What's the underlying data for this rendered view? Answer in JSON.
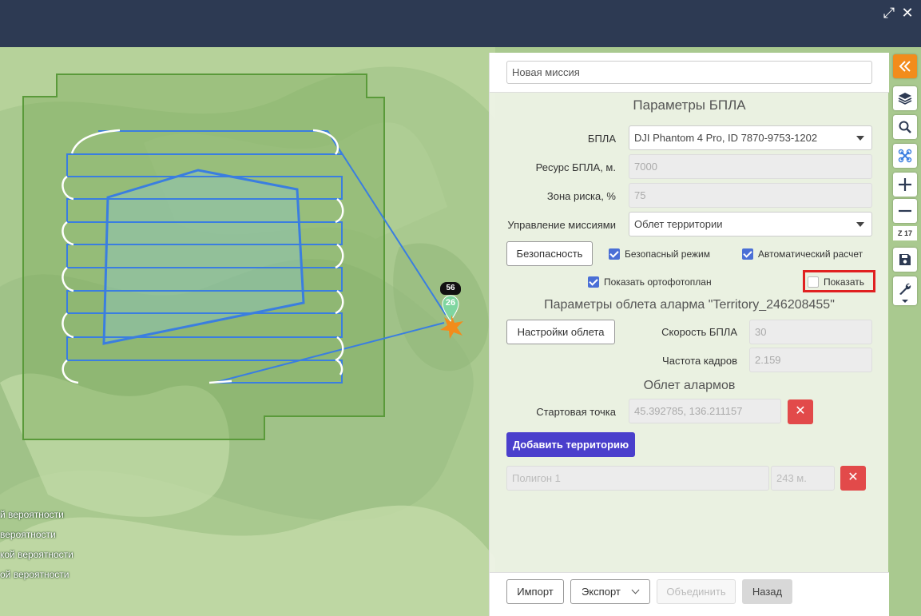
{
  "window": {
    "expand_icon": "expand-icon",
    "close_icon": "close-icon"
  },
  "map": {
    "legend": [
      "й вероятности",
      "вероятности",
      "кой вероятности",
      "ой вероятности"
    ],
    "marker_badge": "56",
    "marker_pin": "26",
    "colors": {
      "flight_path": "#3a7ee0",
      "zone": "#5a9a3a",
      "start_point": "#f28c1c",
      "pin": "#7fd6a0"
    }
  },
  "panel": {
    "mission_name": "Новая миссия",
    "uav_params_title": "Параметры БПЛА",
    "uav_label": "БПЛА",
    "uav_value": "DJI Phantom 4 Pro, ID 7870-9753-1202",
    "resource_label": "Ресурс БПЛА, м.",
    "resource_value": "7000",
    "risk_label": "Зона риска, %",
    "risk_value": "75",
    "control_label": "Управление миссиями",
    "control_value": "Облет территории",
    "safety_button": "Безопасность",
    "safe_mode_label": "Безопасный режим",
    "safe_mode_checked": true,
    "auto_calc_label": "Автоматический расчет",
    "auto_calc_checked": true,
    "show_ortho_label": "Показать ортофотоплан",
    "show_ortho_checked": true,
    "show_label": "Показать",
    "show_checked": false,
    "alarm_params_title": "Параметры облета аларма  \"Territory_246208455\"",
    "flight_settings_button": "Настройки облета",
    "speed_label": "Скорость БПЛА",
    "speed_value": "30",
    "frame_rate_label": "Частота кадров",
    "frame_rate_value": "2.159",
    "alarms_title": "Облет алармов",
    "start_point_label": "Стартовая точка",
    "start_point_value": "45.392785, 136.211157",
    "add_territory_button": "Добавить территорию",
    "polygon_name": "Полигон 1",
    "polygon_length": "243 м.",
    "delete_symbol": "✕"
  },
  "footer": {
    "import_button": "Импорт",
    "export_button": "Экспорт",
    "merge_button": "Объединить",
    "back_button": "Назад"
  },
  "toolbar": {
    "collapse_icon": "double-chevron-left-icon",
    "layers_icon": "layers-icon",
    "search_icon": "search-icon",
    "drone_icon": "drone-icon",
    "zoom_in_icon": "plus-icon",
    "zoom_out_icon": "minus-icon",
    "zoom_level": "Z 17",
    "save_icon": "save-icon",
    "wrench_icon": "wrench-icon"
  }
}
